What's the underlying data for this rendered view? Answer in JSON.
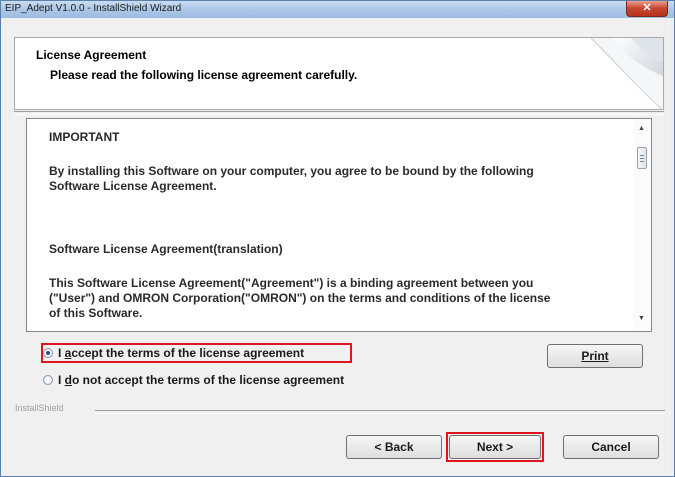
{
  "window": {
    "title": "EIP_Adept V1.0.0 - InstallShield Wizard",
    "close_glyph": "✕"
  },
  "header": {
    "title": "License Agreement",
    "subtitle": "Please read the following license agreement carefully."
  },
  "license": {
    "lines": [
      "IMPORTANT",
      "By installing this Software on your computer, you agree to be bound by the following",
      "Software License Agreement.",
      "Software License Agreement(translation)",
      "This Software License Agreement(\"Agreement\") is a binding agreement between you",
      "(\"User\") and OMRON Corporation(\"OMRON\") on the terms and conditions of the license",
      "of this Software."
    ]
  },
  "options": {
    "accept": {
      "label": "I accept the terms of the license agreement",
      "mnemonic": "a",
      "selected": true
    },
    "decline": {
      "label": "I do not accept the terms of the license agreement",
      "mnemonic": "d",
      "selected": false
    }
  },
  "buttons": {
    "print": "Print",
    "back": "< Back",
    "next": "Next >",
    "cancel": "Cancel"
  },
  "footer": {
    "brand": "InstallShield"
  },
  "colors": {
    "highlight": "#e0141e",
    "title_bar": "#a9c5e6"
  }
}
